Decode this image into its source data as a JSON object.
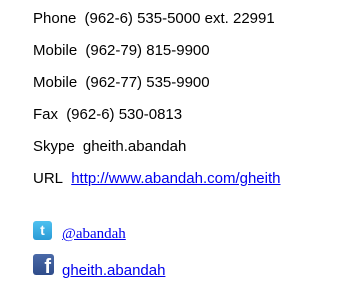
{
  "contact": {
    "phone": {
      "label": "Phone",
      "value": "(962-6) 535-5000 ext. 22991"
    },
    "mobile1": {
      "label": "Mobile",
      "value": "(962-79) 815-9900"
    },
    "mobile2": {
      "label": "Mobile",
      "value": "(962-77) 535-9900"
    },
    "fax": {
      "label": "Fax",
      "value": "(962-6) 530-0813"
    },
    "skype": {
      "label": "Skype",
      "value": "gheith.abandah"
    },
    "url": {
      "label": "URL",
      "value": "http://www.abandah.com/gheith"
    }
  },
  "social": {
    "twitter": {
      "icon": "twitter-icon",
      "glyph": "t",
      "handle": "@abandah",
      "color": "#33aaf0"
    },
    "facebook": {
      "icon": "facebook-icon",
      "glyph": "f",
      "handle": "gheith.abandah",
      "color": "#3b5998"
    }
  },
  "colors": {
    "link": "#0000ee",
    "text": "#000000"
  }
}
